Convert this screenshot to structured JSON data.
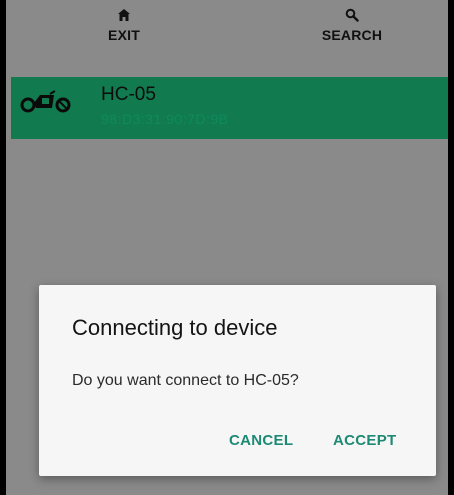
{
  "toolbar": {
    "exit_label": "EXIT",
    "exit_icon": "home-icon",
    "search_label": "SEARCH",
    "search_icon": "search-icon"
  },
  "device_list": {
    "items": [
      {
        "name": "HC-05",
        "address": "98:D3:31:90:7D:9B",
        "icon": "robot-vehicle-icon"
      }
    ]
  },
  "dialog": {
    "title": "Connecting to device",
    "message": "Do you want connect to HC-05?",
    "cancel_label": "CANCEL",
    "accept_label": "ACCEPT"
  },
  "colors": {
    "background": "#8a8a8a",
    "device_row": "#117a4f",
    "accent": "#1d8a73",
    "dialog_background": "#f6f6f6"
  }
}
